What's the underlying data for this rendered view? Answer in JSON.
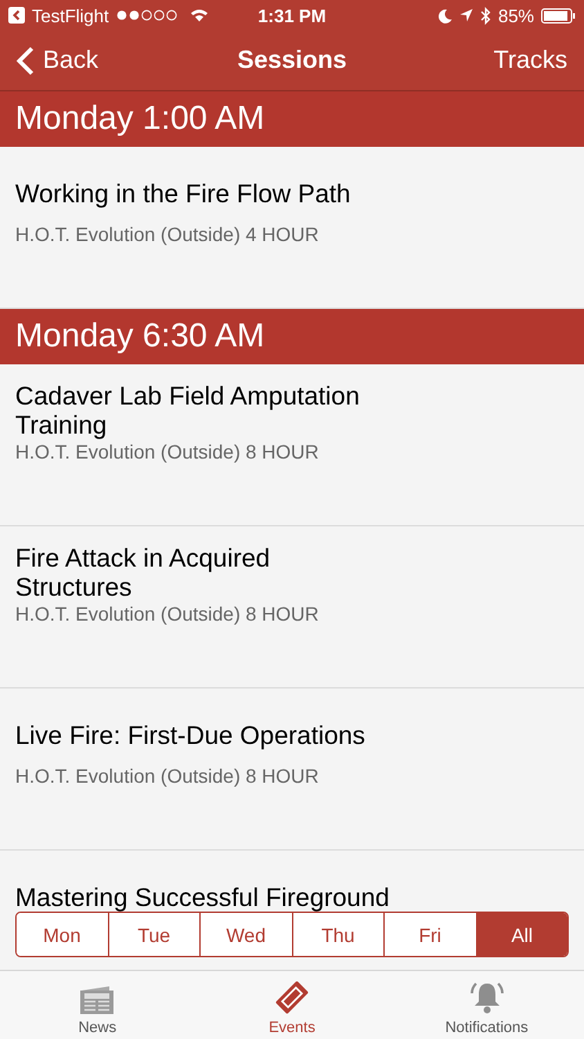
{
  "status_bar": {
    "app": "TestFlight",
    "time": "1:31 PM",
    "battery": "85%"
  },
  "nav_bar": {
    "back": "Back",
    "title": "Sessions",
    "right": "Tracks"
  },
  "sections": [
    {
      "heading": "Monday 1:00 AM",
      "sessions": [
        {
          "title": "Working in the Fire Flow Path",
          "subtitle": "H.O.T. Evolution (Outside) 4 HOUR"
        }
      ]
    },
    {
      "heading": "Monday 6:30 AM",
      "sessions": [
        {
          "title": "Cadaver Lab Field Amputation Training",
          "subtitle": "H.O.T. Evolution (Outside) 8 HOUR"
        },
        {
          "title": "Fire Attack in Acquired Structures",
          "subtitle": "H.O.T. Evolution (Outside) 8 HOUR"
        },
        {
          "title": "Live Fire: First-Due Operations",
          "subtitle": "H.O.T. Evolution (Outside) 8 HOUR"
        },
        {
          "title": "Mastering Successful Fireground"
        }
      ]
    }
  ],
  "day_filter": [
    {
      "label": "Mon",
      "selected": false
    },
    {
      "label": "Tue",
      "selected": false
    },
    {
      "label": "Wed",
      "selected": false
    },
    {
      "label": "Thu",
      "selected": false
    },
    {
      "label": "Fri",
      "selected": false
    },
    {
      "label": "All",
      "selected": true
    }
  ],
  "tab_bar": [
    {
      "label": "News",
      "kind": "news",
      "selected": false
    },
    {
      "label": "Events",
      "kind": "ticket",
      "selected": true
    },
    {
      "label": "Notifications",
      "kind": "bell",
      "selected": false
    }
  ]
}
